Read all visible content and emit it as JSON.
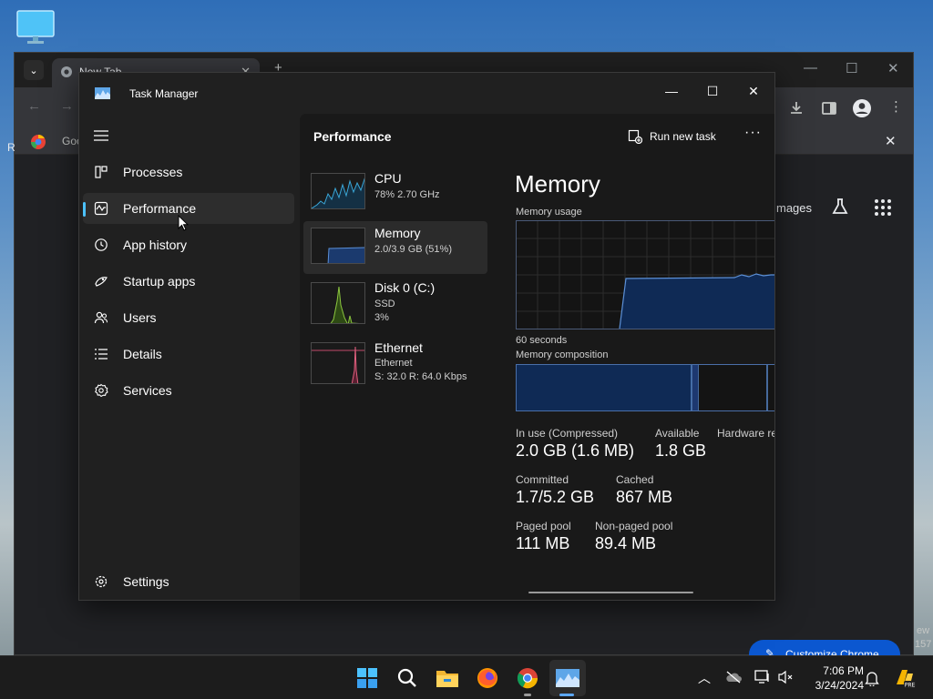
{
  "chrome": {
    "tab_title": "New Tab",
    "bookmark_label": "Goo",
    "google_images": "mages",
    "customize_label": "Customize Chrome",
    "side_text_top": "ew",
    "side_text_bottom": "157",
    "left_edge_letter": "R"
  },
  "task_manager": {
    "title": "Task Manager",
    "nav": [
      {
        "label": "Processes",
        "icon": "processes-icon"
      },
      {
        "label": "Performance",
        "icon": "performance-icon",
        "selected": true
      },
      {
        "label": "App history",
        "icon": "history-icon"
      },
      {
        "label": "Startup apps",
        "icon": "startup-icon"
      },
      {
        "label": "Users",
        "icon": "users-icon"
      },
      {
        "label": "Details",
        "icon": "details-icon"
      },
      {
        "label": "Services",
        "icon": "services-icon"
      }
    ],
    "settings_label": "Settings",
    "header_title": "Performance",
    "run_new_task": "Run new task",
    "more": "···",
    "perf_items": [
      {
        "name": "CPU",
        "sub1": "78%  2.70 GHz",
        "sub2": "",
        "sub3": ""
      },
      {
        "name": "Memory",
        "sub1": "2.0/3.9 GB (51%)",
        "sub2": "",
        "sub3": "",
        "selected": true
      },
      {
        "name": "Disk 0 (C:)",
        "sub1": "SSD",
        "sub2": "3%",
        "sub3": ""
      },
      {
        "name": "Ethernet",
        "sub1": "Ethernet",
        "sub2": "S: 32.0  R: 64.0 Kbps",
        "sub3": ""
      }
    ],
    "memory": {
      "title": "Memory",
      "usage_label": "Memory usage",
      "seconds_label": "60 seconds",
      "composition_label": "Memory composition",
      "stats": {
        "in_use_label": "In use (Compressed)",
        "in_use_value": "2.0 GB (1.6 MB)",
        "available_label": "Available",
        "available_value": "1.8 GB",
        "hardware_label": "Hardware re",
        "committed_label": "Committed",
        "committed_value": "1.7/5.2 GB",
        "cached_label": "Cached",
        "cached_value": "867 MB",
        "paged_label": "Paged pool",
        "paged_value": "111 MB",
        "nonpaged_label": "Non-paged pool",
        "nonpaged_value": "89.4 MB"
      }
    }
  },
  "taskbar": {
    "time": "7:06 PM",
    "date": "3/24/2024",
    "icons": [
      "windows-start-icon",
      "search-icon",
      "file-explorer-icon",
      "firefox-icon",
      "chrome-icon",
      "task-manager-icon"
    ]
  },
  "colors": {
    "accent": "#4cc2ff",
    "memory_fill": "#0f2a55",
    "memory_line": "#5b8fd6"
  }
}
